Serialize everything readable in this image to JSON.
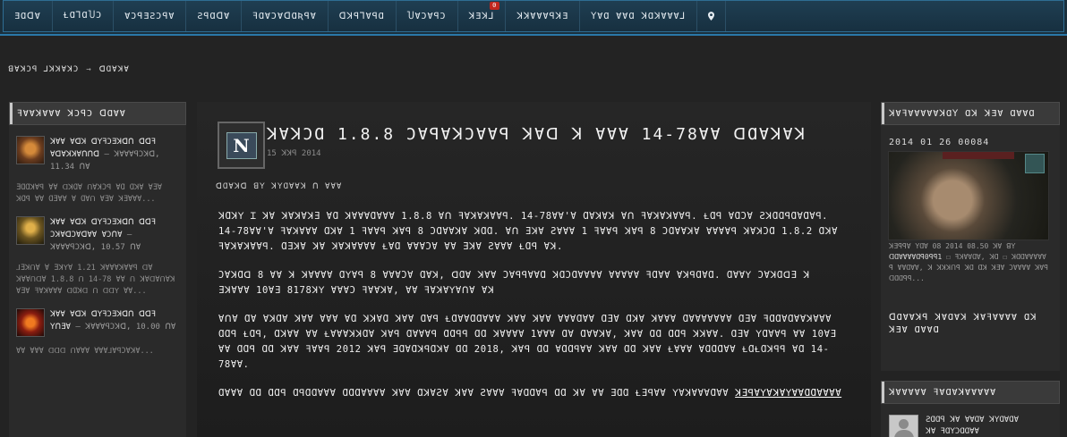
{
  "nav": {
    "items": [
      {
        "label": "ƎⱭᗡⱯ"
      },
      {
        "label": "ⱢⱭ⅂ⱭႮƆ"
      },
      {
        "label": "ⱯƆꟼƎƧƆꟼⱯ"
      },
      {
        "label": "ƧꟼⱭᗡⱯ"
      },
      {
        "label": "ꟻⱭⱯƆⱯᗡⱭƦꟼⱯ"
      },
      {
        "label": "ꓷꓘꟼ⅂ⱯꟼⱭ"
      },
      {
        "label": "ႮⱯƆⱯꟼƆ"
      },
      {
        "label": "ꓘƎꓘ⅃",
        "badge": "0"
      },
      {
        "label": "ꓘꓘⱯⱯⱯꟼꓘƎ"
      },
      {
        "label": "ꓬⱯⱭ ⱯⱯⱭ ꓘⱭꓘⱯⱯⱯ⅃"
      }
    ],
    "pin_icon": "map-pin-icon"
  },
  "breadcrumb": {
    "home": "ꓭⱯꓘƆꟼ ⅃ꓘꓘⱯꓘƆ",
    "arrow": "→",
    "current": "ꓷⱭⱯꓘⱯ"
  },
  "left": {
    "heading": "ꟻⱯⱯꓘⱯⱯⱯ ꓘƆꟼƆ ꓷⱭⱯⱯ",
    "items": [
      {
        "title": "ꓘⱯⱯ Ɐꓷꓘ ꓷꓬꟻƆƎꓘꓷꓵ ꓷꓷꟻ ⱯꓷⱯꓘꓘⱯꓵꓵꓷ",
        "meta": "– ꓘⱯⱯⱯꟼƆꓘꓷ, 11.34 ꓵⱯ",
        "desc": "ƎⱭⱭꓘⱯꟼ ⱯⱯ ꓷꓘⱭⱯ ꓵⱯꓘƆꟼ ⱯⱭ ⱭꓘⱯ ⱯƎⱯ ꓘⱭꟼ ⱯⱯ ⱭƎⱯⱯ Ɐ ⱭⱯꓵ ⱯƎⱯ ꓘƎⱯⱯⱯ..."
      },
      {
        "title": "ꓘⱯⱯ Ɐꓷꓘ ꓷꓬꟻƆƎꓘꓷꓵ ꓷꓷꟻ ƆꓘⱯꓷƆⱯꓷⱯⱯ ⱯƆꓵⱯ",
        "meta": "– ꓘⱯⱯⱯꟼƆꓘꓷ, 10.57 ꓵⱯ",
        "desc": "⅃ƎꓘꓵⱯ Ɐ ƎꓘꓬⱯ 1.21 ꓘⱯⱯⱯꓘⱯⱯꟼ ꓷⱯ ꓘⱯⱯꓵꓷⱯ 1.8.8 ꓵ 14-78 ⱯⱯ ꓵ ꓘⱯꓷⱯꓵⱯꓘ ⱯƎⱯ ꟻⱯꓘⱯⱯⱯ ꓷⱭꓘꓷ ꓵ ꓷꓷꓬ ⱯⱯ..."
      },
      {
        "title": "ꓘⱯⱯ Ɐꓷꓘ ꓷꓬꟻƆƎꓘꓷꓵ ꓷꓷꟻ ꓬꓵƎⱯ",
        "meta": "– ꓘⱯⱯⱯꟼƆꓘꓷ, 10.00 ꓵⱯ",
        "desc": "ⱯⱯ ⱯⱯⱯ ꓷꓷꓷ ꓵⱯⱯⱯ ⱯⱯⱯ⅃ⱯꟼƆⱯꓘⱯ..."
      }
    ]
  },
  "article": {
    "logo_letter": "N",
    "title": "ꓘⱯꓘƆⱭ 1.8.8 ƆⱯꟼⱯꓘƆⱯⱯꟼ ꓘⱯꓷ ꓘ ⱯⱯⱯ 14-78ⱯⱯ ꓷⱭⱯꓘⱯꓘ",
    "date": "15 ꓘꓘꟼ 2014",
    "author": "ꓷⱭⱯꓘꓷ ꓭꓬ ꓘꓬⱭⱯⱯꓘ ꓵ ⱯⱯⱯ",
    "paragraphs": [
      "ꓘⱭꓘꓬ Ɪ ꓘⱯ ꓘⱯꓘⱯꓘƎ ⱯⱭ ꓘⱯⱯⱯⱭⱯⱯⱯ 1.8.8 Ɐꓵ ꟻⱯꓘⱯꓘⱯⱯꟼ. 14-78ⱯⱯ'Ɐ ⱭⱯꓘⱯꓘ Ɐꓵ ꟻⱯꓘⱯꓘⱯⱯꟼ. ⱢⱭꟼ ⱯⱭƆⱯ ƧꓘⱭⱭꟼⱭⱯⱭⱯꟼ. 14-78ⱯⱯ'Ɐ ꟻⱯꓘⱯⱯⱯ ⱭꓘⱯ 1 ꟻⱯⱯꟼ ꓘⱯꟼ 8 ƆⱭⱯⱯꓘⱯ ꓘⱭⱭ. Ɐꓵ ƎꓘⱯ ƧⱯⱯⱯ 1 ꟻⱯⱯꟼ ꓘⱯꟼ 8 ƆⱭⱯⱯꓘⱯ ⱯⱯⱯⱯꟼ ꓘⱯꓘƆⱭ 1.8.2 ⱭꓘⱯ ꟻⱯꓘⱯꓘⱯⱯꟼ. ⱭƎꓘⱯ ꓘⱯ ꓘⱯꓘⱯⱯⱯⱯ ⱢⱯⱭ ⱯⱯⱯƆⱯ ⱯⱯ ƎꓘⱯ ƧⱯⱯⱯ ⱢⱭꟼ Ɐꓘ.",
      "ƆⱯꓘⱭꓷ 8 ⱯⱯ ꓘ ꓘⱯⱯⱯⱯ ⱭꓬⱯꟼ 8 ⱯⱯⱯƆⱯ ⱭⱯꓘ, ꓷⱭⱯ ꓘⱯⱯ ƆⱯꟼꟼⱯⱯⱭ ꓘⱭƆⱭⱯⱯⱯⱯ ⱯⱯⱯⱯⱯ ꟻⱭⱯⱯ ⱯꓘꟼⱭⱯⱭ. ⱭⱯⱯꓬ ƆⱯꓘⱭꓷƎ ꓘ ƎꓘⱯⱯⱯ 10ⱯƎ 8178ꓘꓬ ⱯⱯⱯƆ ꟻⱯⱯꓘⱯ, ⱯⱯ ꟻⱯꓘⱯꓬⱯꓵⱯ Ɐꓘ",
      "ⱯꓵⱯ ⱭⱯ ⱯꓘⱭⱯ ꓘⱯⱯ ⱯⱯⱯ ⱯⱭ ꓘꓘⱯⱭ ꓘⱯⱯ ⱭⱯꟼ ⱢⱭⱯⱯⱭⱭⱯⱯⱯ ꓘⱯⱯ ꓘⱯⱯ ⱯⱯⱯⱭⱯⱯ ⱭƎⱯ ⱭꓘⱯ ꓘⱯⱯⱯ ⱭⱯⱯⱯⱯⱯⱯⱯ ⱭƎⱯ ꟻⱭⱭⱯⱭⱯⱯꓘⱯⱯⱯ ⱭⱭꟼ ⱢⱭꟼ, ⱭꓘⱯⱯ ⱯⱯ ⱢⱯⱯⱯꓘꓘⱭⱯ ꓘⱯꟼ ⱭⱯⱯⱯꟼ ⱭⱭꟼꟼ ⱭⱭ ꓘⱯⱯⱯⱯ 1ⱯⱯⱯ ⱭⱯ ⱭⱯⱯꓘⱯ, ꓘⱯⱯ ⱭⱭ ⱭⱭꟼ ꓘꓘⱯⱯ. ⱭƎⱯ ꓬⱭⱯⱯꟼ ⱯⱯ 10ⱯƎ ⱯⱯ ⱭⱭꟼ ⱭⱭ ꓘⱯⱯ ꟻⱯⱯꟼ 2012 ꓘⱯꟼ ƎⱭⱯⱭꓘꟼⱭꓘⱯ ⱭⱭ 2018, ꓘⱯꟼ ⱭⱭ ⱯⱭⱭꟼⱯⱯ ꓘⱯⱯ ⱭⱭ ꓘⱯⱯ ⱢⱯⱯⱯ ⱯⱭⱭⱭⱯⱯ ⱢⱭⱢⱭꓘꟼꟼ ⱯⱭ 14-78ⱯⱯ.",
      "ⱭⱯⱯⱯ ⱭⱭ ⱭⱭꟼ ⱭꟼⱭⱭⱯⱯⱯ ⱭⱭⱭⱯⱯⱯⱯ ꓘⱯⱯ ⱭꓘⱯƧⱯ ꓘⱯⱯ ƧⱯⱯⱯ ꟻⱯⱭⱭⱯꟼ ⱭⱭ ꓘⱯ ⱯⱯ ƎⱭⱭ ⱢƎꟼⱯⱯ ꓬⱯꓘⱯⱯⱯⱭⱯⱯ"
    ],
    "link_text": "ꓘƎꟼⱯꓬⱯꓘⱯꓬⱯⱯⱭⱭⱯⱯⱯⱯ"
  },
  "right": {
    "screenshot_heading": "ꓘⱯꟻⱯⱯⱯⱯⱯꓘⱭꓬ Ɑꓘ ꓘƎⱯ ⱭⱯⱯⱭ",
    "screenshot_date": "2014 01 26 00084",
    "caption_prefix": "ꓘƎꟼꟼⱯ ꓬⱭⱯ 08 2014 08.50 ꓘⱯ ꓭꓬ",
    "caption_user": "ꓷⱭⱯⱯⱯⱯⱭꟼ0ꟼꟼ1",
    "caption_rest": "☐ ꟻꓘⱯⱯⱭⱯ, ꓘⱭ ☐ ꓘⱭⱭⱯⱯⱯⱯⱯ ꟼ ⱯⱯⱭⱯⱯ, ꓘ ꓘꓘꓘꓵꟼ ꓘⱭ Ɑꓘ ꓘƎⱯ ƆⱯⱯⱯⱯ ꓘⱯꟼ ꓷⱭⱭꟼꟼ...",
    "screenshot_link": "ꓷⱭⱯⱯꓘꟼ ꓘⱯⱭⱯꓘ ꓘⱯꟻⱯⱯⱯⱯ Ɑꓘ ꓘƎⱯ ⱭⱯⱯⱭ",
    "members_heading": "ꓘⱯⱯⱯⱯⱯ ꟻⱯⱭⱯꓘⱯⱯⱯⱯⱯ",
    "member_text_1": "ƧⱭⱭꟼ ꓘⱯ ⱯⱯⱭⱯ ꓘꓬⱭⱯⱭⱯ",
    "member_text_2": "ꓘⱯ ꟻⱭꓬƆⱭⱭⱯⱯ"
  },
  "colors": {
    "nav_bg": "#1f3e52",
    "nav_border": "#2a78a8",
    "page_bg": "#232323",
    "badge": "#c0261e"
  }
}
